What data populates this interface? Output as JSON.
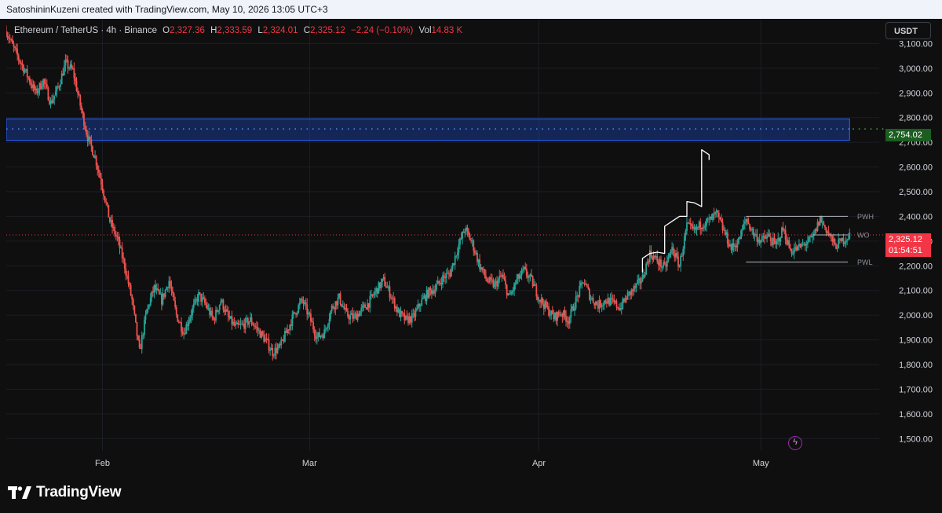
{
  "topbar": {
    "attribution": "SatoshininKuzeni created with TradingView.com, May 10, 2026 13:05 UTC+3"
  },
  "legend": {
    "symbol": "Ethereum / TetherUS · 4h · Binance",
    "open_label": "O",
    "open": "2,327.36",
    "high_label": "H",
    "high": "2,333.59",
    "low_label": "L",
    "low": "2,324.01",
    "close_label": "C",
    "close": "2,325.12",
    "change": "−2.24 (−0.10%)",
    "vol_label": "Vol",
    "volume": "14.83 K"
  },
  "currency_button": "USDT",
  "price_tags": {
    "zone_price": "2,754.02",
    "last_price": "2,325.12",
    "countdown": "01:54:51"
  },
  "footer": {
    "brand": "TradingView"
  },
  "colors": {
    "up": "#26a69a",
    "down": "#ef5350",
    "zone_fill": "#1a3a8f",
    "zone_border": "#2962ff",
    "zone_tag": "#1b5e20",
    "last_tag": "#f23645",
    "background": "#0f0f0f"
  },
  "chart_data": {
    "type": "candlestick",
    "interval": "4h",
    "ylim": [
      1450,
      3200
    ],
    "y_ticks": [
      "3,100.00",
      "3,000.00",
      "2,900.00",
      "2,800.00",
      "2,700.00",
      "2,600.00",
      "2,500.00",
      "2,400.00",
      "2,300.00",
      "2,200.00",
      "2,100.00",
      "2,000.00",
      "1,900.00",
      "1,800.00",
      "1,700.00",
      "1,600.00",
      "1,500.00"
    ],
    "y_tick_values": [
      3100,
      3000,
      2900,
      2800,
      2700,
      2600,
      2500,
      2400,
      2300,
      2200,
      2100,
      2000,
      1900,
      1800,
      1700,
      1600,
      1500
    ],
    "x_ticks": [
      "Feb",
      "Mar",
      "Apr",
      "May"
    ],
    "x_tick_dates": [
      "2026-02-01",
      "2026-03-01",
      "2026-04-01",
      "2026-05-01"
    ],
    "x_range": [
      "2026-01-19",
      "2026-05-17"
    ],
    "price_path": [
      [
        "2026-01-19",
        3150
      ],
      [
        "2026-01-20",
        3080
      ],
      [
        "2026-01-21",
        3020
      ],
      [
        "2026-01-22",
        2960
      ],
      [
        "2026-01-23",
        2900
      ],
      [
        "2026-01-24",
        2950
      ],
      [
        "2026-01-25",
        2860
      ],
      [
        "2026-01-26",
        2920
      ],
      [
        "2026-01-27",
        3020
      ],
      [
        "2026-01-28",
        2990
      ],
      [
        "2026-01-29",
        2850
      ],
      [
        "2026-01-30",
        2720
      ],
      [
        "2026-01-31",
        2640
      ],
      [
        "2026-02-01",
        2520
      ],
      [
        "2026-02-02",
        2380
      ],
      [
        "2026-02-03",
        2310
      ],
      [
        "2026-02-04",
        2200
      ],
      [
        "2026-02-05",
        2060
      ],
      [
        "2026-02-06",
        1850
      ],
      [
        "2026-02-07",
        2020
      ],
      [
        "2026-02-08",
        2110
      ],
      [
        "2026-02-09",
        2060
      ],
      [
        "2026-02-10",
        2140
      ],
      [
        "2026-02-11",
        2000
      ],
      [
        "2026-02-12",
        1930
      ],
      [
        "2026-02-13",
        2010
      ],
      [
        "2026-02-14",
        2080
      ],
      [
        "2026-02-15",
        2040
      ],
      [
        "2026-02-16",
        1980
      ],
      [
        "2026-02-17",
        2060
      ],
      [
        "2026-02-18",
        1990
      ],
      [
        "2026-02-19",
        1950
      ],
      [
        "2026-02-20",
        1960
      ],
      [
        "2026-02-21",
        1980
      ],
      [
        "2026-02-22",
        1940
      ],
      [
        "2026-02-23",
        1900
      ],
      [
        "2026-02-24",
        1850
      ],
      [
        "2026-02-25",
        1870
      ],
      [
        "2026-02-26",
        1940
      ],
      [
        "2026-02-27",
        2010
      ],
      [
        "2026-02-28",
        2060
      ],
      [
        "2026-03-01",
        1990
      ],
      [
        "2026-03-02",
        1910
      ],
      [
        "2026-03-03",
        1930
      ],
      [
        "2026-03-04",
        2030
      ],
      [
        "2026-03-05",
        2070
      ],
      [
        "2026-03-06",
        2000
      ],
      [
        "2026-03-07",
        1990
      ],
      [
        "2026-03-08",
        2020
      ],
      [
        "2026-03-09",
        2050
      ],
      [
        "2026-03-10",
        2100
      ],
      [
        "2026-03-11",
        2140
      ],
      [
        "2026-03-12",
        2080
      ],
      [
        "2026-03-13",
        2010
      ],
      [
        "2026-03-14",
        1980
      ],
      [
        "2026-03-15",
        1990
      ],
      [
        "2026-03-16",
        2050
      ],
      [
        "2026-03-17",
        2090
      ],
      [
        "2026-03-18",
        2110
      ],
      [
        "2026-03-19",
        2150
      ],
      [
        "2026-03-20",
        2170
      ],
      [
        "2026-03-21",
        2270
      ],
      [
        "2026-03-22",
        2350
      ],
      [
        "2026-03-23",
        2290
      ],
      [
        "2026-03-24",
        2200
      ],
      [
        "2026-03-25",
        2140
      ],
      [
        "2026-03-26",
        2120
      ],
      [
        "2026-03-27",
        2160
      ],
      [
        "2026-03-28",
        2070
      ],
      [
        "2026-03-29",
        2140
      ],
      [
        "2026-03-30",
        2180
      ],
      [
        "2026-03-31",
        2140
      ],
      [
        "2026-04-01",
        2070
      ],
      [
        "2026-04-02",
        2030
      ],
      [
        "2026-04-03",
        1990
      ],
      [
        "2026-04-04",
        2010
      ],
      [
        "2026-04-05",
        1980
      ],
      [
        "2026-04-06",
        2060
      ],
      [
        "2026-04-07",
        2140
      ],
      [
        "2026-04-08",
        2070
      ],
      [
        "2026-04-09",
        2040
      ],
      [
        "2026-04-10",
        2060
      ],
      [
        "2026-04-11",
        2050
      ],
      [
        "2026-04-12",
        2030
      ],
      [
        "2026-04-13",
        2080
      ],
      [
        "2026-04-14",
        2110
      ],
      [
        "2026-04-15",
        2150
      ],
      [
        "2026-04-16",
        2250
      ],
      [
        "2026-04-17",
        2220
      ],
      [
        "2026-04-18",
        2190
      ],
      [
        "2026-04-19",
        2270
      ],
      [
        "2026-04-20",
        2200
      ],
      [
        "2026-04-21",
        2360
      ],
      [
        "2026-04-22",
        2340
      ],
      [
        "2026-04-23",
        2370
      ],
      [
        "2026-04-24",
        2380
      ],
      [
        "2026-04-25",
        2410
      ],
      [
        "2026-04-26",
        2340
      ],
      [
        "2026-04-27",
        2270
      ],
      [
        "2026-04-28",
        2300
      ],
      [
        "2026-04-29",
        2390
      ],
      [
        "2026-04-30",
        2330
      ],
      [
        "2026-05-01",
        2300
      ],
      [
        "2026-05-02",
        2320
      ],
      [
        "2026-05-03",
        2280
      ],
      [
        "2026-05-04",
        2350
      ],
      [
        "2026-05-05",
        2260
      ],
      [
        "2026-05-06",
        2270
      ],
      [
        "2026-05-07",
        2290
      ],
      [
        "2026-05-08",
        2310
      ],
      [
        "2026-05-09",
        2390
      ],
      [
        "2026-05-10",
        2340
      ],
      [
        "2026-05-11",
        2280
      ],
      [
        "2026-05-12",
        2300
      ],
      [
        "2026-05-13",
        2325
      ]
    ],
    "zone": {
      "low": 2708,
      "high": 2795,
      "price": 2754.02,
      "end_date": "2026-05-13"
    },
    "last_price": 2325.12,
    "levels": [
      {
        "name": "PWH",
        "price": 2400,
        "start": "2026-04-29",
        "end": "2026-05-17"
      },
      {
        "name": "WO",
        "price": 2325,
        "start": "2026-05-08",
        "end": "2026-05-17"
      },
      {
        "name": "PWL",
        "price": 2215,
        "start": "2026-04-29",
        "end": "2026-05-17"
      }
    ],
    "drawing_path": [
      [
        "2026-04-15",
        2175
      ],
      [
        "2026-04-15",
        2230
      ],
      [
        "2026-04-16",
        2250
      ],
      [
        "2026-04-17",
        2255
      ],
      [
        "2026-04-18",
        2250
      ],
      [
        "2026-04-18",
        2360
      ],
      [
        "2026-04-19",
        2380
      ],
      [
        "2026-04-20",
        2400
      ],
      [
        "2026-04-21",
        2400
      ],
      [
        "2026-04-21",
        2460
      ],
      [
        "2026-04-22",
        2455
      ],
      [
        "2026-04-23",
        2440
      ],
      [
        "2026-04-23",
        2590
      ],
      [
        "2026-04-23",
        2650
      ],
      [
        "2026-04-23",
        2670
      ],
      [
        "2026-04-24",
        2650
      ],
      [
        "2026-04-24",
        2630
      ]
    ]
  }
}
